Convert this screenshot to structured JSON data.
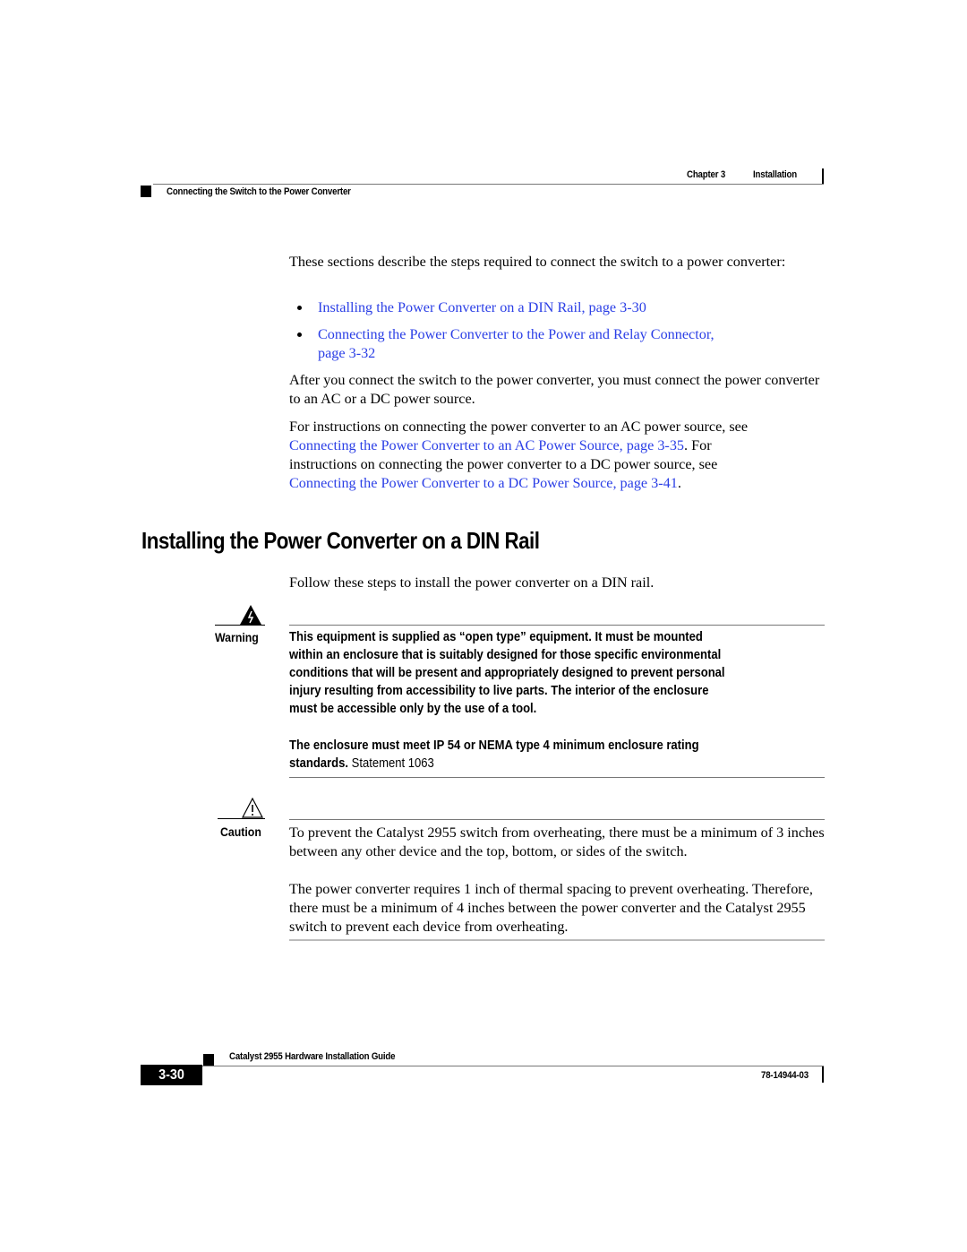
{
  "header": {
    "chapter": "Chapter 3",
    "chapter_title": "Installation",
    "section": "Connecting the Switch to the Power Converter"
  },
  "intro": {
    "paragraph": "These sections describe the steps required to connect the switch to a power converter:",
    "bullets": [
      {
        "text": "Installing the Power Converter on a DIN Rail, page 3-30"
      },
      {
        "line1": "Connecting the Power Converter to the Power and Relay Connector,",
        "line2": "page 3-32"
      }
    ],
    "after_paragraph": "After you connect the switch to the power converter, you must connect the power converter to an AC or a DC power source.",
    "instructions": {
      "line1": "For instructions on connecting the power converter to an AC power source, see",
      "link_ac": "Connecting the Power Converter to an AC Power Source, page 3-35",
      "mid": ". For",
      "line3": "instructions on connecting the power converter to a DC power source, see",
      "link_dc": "Connecting the Power Converter to a DC Power Source, page 3-41",
      "end": "."
    }
  },
  "section": {
    "title": "Installing the Power Converter on a DIN Rail",
    "lead": "Follow these steps to install the power converter on a DIN rail."
  },
  "warning": {
    "label": "Warning",
    "icon": "electrical-hazard-icon",
    "lines": [
      "This equipment is supplied as “open type” equipment. It must be mounted",
      "within an enclosure that is suitably designed for those specific environmental",
      "conditions that will be present and appropriately designed to prevent personal",
      "injury resulting from accessibility to live parts. The interior of the enclosure",
      "must be accessible only by the use of a tool."
    ],
    "second_line1": "The enclosure must meet IP 54 or NEMA type 4 minimum enclosure rating",
    "second_line2_bold": "standards.",
    "statement": "Statement 1063"
  },
  "caution": {
    "label": "Caution",
    "icon": "caution-triangle-icon",
    "paragraph1": "To prevent the Catalyst 2955 switch from overheating, there must be a minimum of 3 inches between any other device and the top, bottom, or sides of the switch.",
    "paragraph2": "The power converter requires 1 inch of thermal spacing to prevent overheating. Therefore, there must be a minimum of 4 inches between the power converter and the Catalyst 2955 switch to prevent each device from overheating."
  },
  "footer": {
    "guide_title": "Catalyst 2955 Hardware Installation Guide",
    "page_number": "3-30",
    "doc_number": "78-14944-03"
  },
  "colors": {
    "link": "#2b3fe6",
    "text": "#000000"
  }
}
